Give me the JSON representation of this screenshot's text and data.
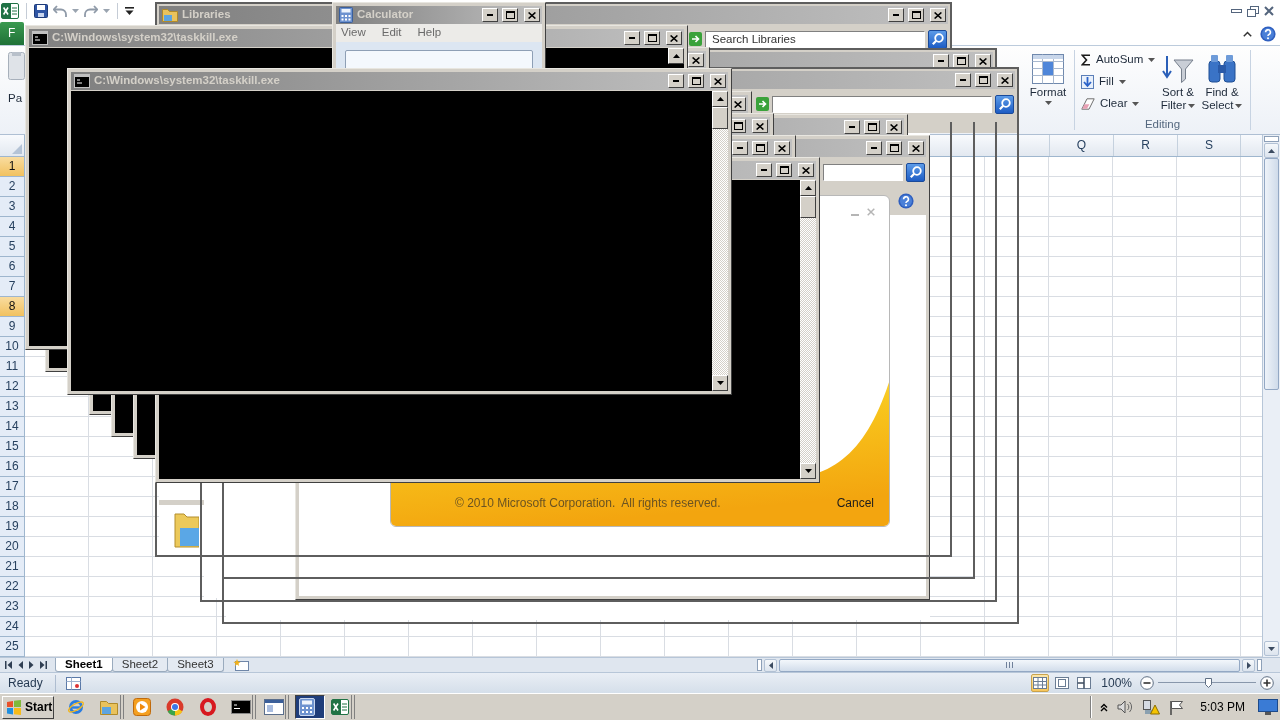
{
  "excel": {
    "file_tab": "F",
    "paste_label": "Pa",
    "format_label": "Format",
    "editing": {
      "small": [
        {
          "kind": "autosum",
          "label": "AutoSum"
        },
        {
          "kind": "fill",
          "label": "Fill"
        },
        {
          "kind": "clear",
          "label": "Clear"
        }
      ],
      "large": [
        {
          "kind": "sort",
          "label": "Sort & Filter"
        },
        {
          "kind": "find",
          "label": "Find & Select"
        }
      ],
      "group_label": "Editing"
    },
    "columns": [
      "Q",
      "R",
      "S"
    ],
    "rows": [
      {
        "label": "1",
        "selected": true
      },
      {
        "label": "2",
        "selected": false
      },
      {
        "label": "3",
        "selected": false
      },
      {
        "label": "4",
        "selected": false
      },
      {
        "label": "5",
        "selected": false
      },
      {
        "label": "6",
        "selected": false
      },
      {
        "label": "7",
        "selected": false
      },
      {
        "label": "8",
        "selected": true
      },
      {
        "label": "9",
        "selected": false
      },
      {
        "label": "10",
        "selected": false
      },
      {
        "label": "11",
        "selected": false
      },
      {
        "label": "12",
        "selected": false
      },
      {
        "label": "13",
        "selected": false
      },
      {
        "label": "14",
        "selected": false
      },
      {
        "label": "15",
        "selected": false
      },
      {
        "label": "16",
        "selected": false
      },
      {
        "label": "17",
        "selected": false
      },
      {
        "label": "18",
        "selected": false
      },
      {
        "label": "19",
        "selected": false
      },
      {
        "label": "20",
        "selected": false
      },
      {
        "label": "21",
        "selected": false
      },
      {
        "label": "22",
        "selected": false
      },
      {
        "label": "23",
        "selected": false
      },
      {
        "label": "24",
        "selected": false
      },
      {
        "label": "25",
        "selected": false
      }
    ],
    "sheet_tabs": [
      {
        "label": "Sheet1",
        "selected": true
      },
      {
        "label": "Sheet2",
        "selected": false
      },
      {
        "label": "Sheet3",
        "selected": false
      }
    ],
    "status": "Ready",
    "views": [
      {
        "kind": "normal",
        "selected": true
      },
      {
        "kind": "page_layout",
        "selected": false
      },
      {
        "kind": "page_break",
        "selected": false
      }
    ],
    "zoom": {
      "reading": "100%",
      "level": 0.52
    }
  },
  "windows": [
    {
      "kind": "explorer",
      "title": "Libraries",
      "search_placeholder": "Search Libraries"
    },
    {
      "kind": "frame"
    },
    {
      "kind": "search_frame"
    },
    {
      "kind": "frame"
    },
    {
      "kind": "search_frame"
    },
    {
      "kind": "splash",
      "copyright": "© 2010 Microsoft Corporation.  All rights reserved.",
      "cancel": "Cancel"
    },
    {
      "kind": "console"
    },
    {
      "kind": "console",
      "title": "C:\\Windows\\system32\\taskkill.exe"
    },
    {
      "kind": "calculator",
      "title": "Calculator",
      "menu": [
        "View",
        "Edit",
        "Help"
      ]
    },
    {
      "kind": "console"
    },
    {
      "kind": "console"
    },
    {
      "kind": "console"
    },
    {
      "kind": "console"
    },
    {
      "kind": "console",
      "title": "C:\\Windows\\system32\\taskkill.exe"
    }
  ],
  "taskbar": {
    "start": "Start",
    "apps": [
      {
        "kind": "ie",
        "active": false,
        "stacked": false
      },
      {
        "kind": "explorer",
        "active": false,
        "stacked": true
      },
      {
        "kind": "media",
        "active": false,
        "stacked": false
      },
      {
        "kind": "chrome",
        "active": false,
        "stacked": false
      },
      {
        "kind": "opera",
        "active": false,
        "stacked": false
      },
      {
        "kind": "cmd",
        "active": false,
        "stacked": true
      },
      {
        "kind": "window",
        "active": false,
        "stacked": true
      },
      {
        "kind": "calculator",
        "active": true,
        "stacked": false
      },
      {
        "kind": "excel",
        "active": false,
        "stacked": true
      }
    ],
    "clock": "5:03 PM"
  }
}
